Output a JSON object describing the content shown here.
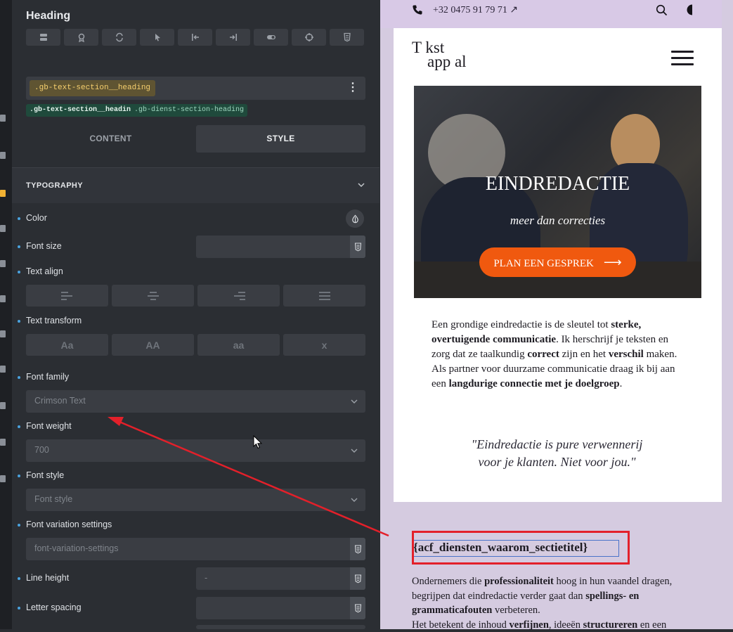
{
  "panel": {
    "title": "Heading",
    "toolbar_icons": [
      "layout-icon",
      "badge-icon",
      "transform-icon",
      "pointer-icon",
      "align-start-icon",
      "align-end-icon",
      "toggle-icon",
      "target-icon",
      "css-icon"
    ],
    "selected_class": ".gb-text-section__heading",
    "classes": [
      ".gb-text-section__heading",
      ".gb-dienst-section-heading"
    ],
    "tabs": {
      "content": "CONTENT",
      "style": "STYLE"
    },
    "typography": {
      "section_label": "TYPOGRAPHY",
      "color_label": "Color",
      "font_size_label": "Font size",
      "text_align_label": "Text align",
      "text_transform_label": "Text transform",
      "text_transform_options": [
        "Aa",
        "AA",
        "aa",
        "x"
      ],
      "font_family_label": "Font family",
      "font_family_value": "Crimson Text",
      "font_weight_label": "Font weight",
      "font_weight_value": "700",
      "font_style_label": "Font style",
      "font_style_placeholder": "Font style",
      "font_variation_label": "Font variation settings",
      "font_variation_placeholder": "font-variation-settings",
      "line_height_label": "Line height",
      "line_height_value": "-",
      "letter_spacing_label": "Letter spacing"
    }
  },
  "preview": {
    "phone": "+32 0475 91 79 71 ↗",
    "logo_line1": "T kst",
    "logo_line2": "app al",
    "hero": {
      "title": "EINDREDACTIE",
      "subtitle": "meer dan correcties",
      "button": "PLAN EEN GESPREK"
    },
    "intro": {
      "t1": "Een grondige eindredactie is de sleutel tot ",
      "b1": "sterke, overtuigende communicatie",
      "t2": ". Ik herschrijf je teksten en zorg dat ze taalkundig ",
      "b2": "correct",
      "t3": " zijn en het ",
      "b3": "verschil",
      "t4": " maken. Als partner voor duurzame communicatie draag ik bij aan een ",
      "b4": "langdurige connectie met je doelgroep",
      "t5": "."
    },
    "quote_line1": "\"Eindredactie is pure verwennerij",
    "quote_line2": "voor je klanten. Niet voor jou.\"",
    "acf_heading": "{acf_diensten_waarom_sectietitel}",
    "para2": {
      "t1": "Ondernemers die ",
      "b1": "professionaliteit",
      "t2": " hoog in hun vaandel dragen, begrijpen dat eindredactie verder gaat dan ",
      "b2": "spellings- en grammaticafouten",
      "t3": " verbeteren.",
      "t4": "Het betekent de inhoud ",
      "b3": "verfijnen",
      "t5": ", ideeën ",
      "b4": "structureren",
      "t6": " en een"
    }
  },
  "colors": {
    "accent_orange": "#f0590f",
    "annotation_red": "#e3202a",
    "class_chip": "#1f4a3c",
    "selected_chip": "#5f5432"
  }
}
